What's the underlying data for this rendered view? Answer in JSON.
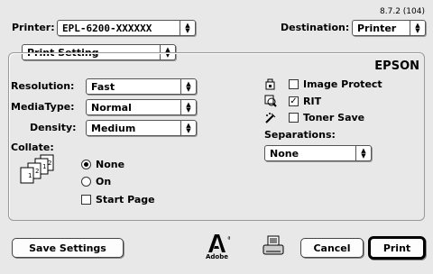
{
  "version": "8.7.2 (104)",
  "printer": {
    "label": "Printer:",
    "value": "EPL-6200-XXXXXX"
  },
  "destination": {
    "label": "Destination:",
    "value": "Printer"
  },
  "panel": {
    "value": "Print Setting"
  },
  "brand": "EPSON",
  "resolution": {
    "label": "Resolution:",
    "value": "Fast"
  },
  "media_type": {
    "label": "MediaType:",
    "value": "Normal"
  },
  "density": {
    "label": "Density:",
    "value": "Medium"
  },
  "options": {
    "image_protect": {
      "label": "Image Protect",
      "checked": false
    },
    "rit": {
      "label": "RIT",
      "checked": true
    },
    "toner_save": {
      "label": "Toner Save",
      "checked": false
    }
  },
  "separations": {
    "label": "Separations:",
    "value": "None"
  },
  "collate": {
    "label": "Collate:",
    "none_label": "None",
    "on_label": "On",
    "selected": "None"
  },
  "start_page": {
    "label": "Start Page",
    "checked": false
  },
  "buttons": {
    "save_settings": "Save Settings",
    "cancel": "Cancel",
    "print": "Print"
  },
  "adobe_label": "Adobe",
  "icons": [
    "image-protect-icon",
    "rit-icon",
    "toner-save-icon",
    "collate-pages-icon",
    "adobe-logo-icon",
    "printer-preview-icon"
  ]
}
